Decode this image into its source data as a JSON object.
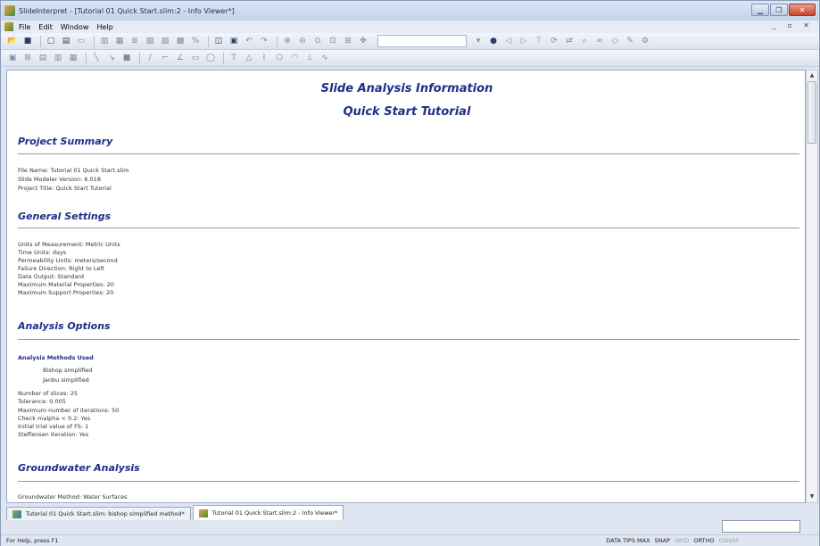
{
  "window": {
    "title": "SlideInterpret - [Tutorial 01 Quick Start.slim:2 - Info Viewer*]"
  },
  "menu": {
    "items": [
      "File",
      "Edit",
      "Window",
      "Help"
    ]
  },
  "doc": {
    "title_line1": "Slide Analysis Information",
    "title_line2": "Quick Start Tutorial",
    "sections": {
      "project_summary": {
        "heading": "Project Summary",
        "lines": [
          "File Name: Tutorial 01 Quick Start.slim",
          "Slide Modeler Version: 6.018",
          "Project Title: Quick Start Tutorial"
        ]
      },
      "general_settings": {
        "heading": "General Settings",
        "lines": [
          "Units of Measurement: Metric Units",
          "Time Units: days",
          "Permeability Units: meters/second",
          "Failure Direction: Right to Left",
          "Data Output: Standard",
          "Maximum Material Properties: 20",
          "Maximum Support Properties: 20"
        ]
      },
      "analysis_options": {
        "heading": "Analysis Options",
        "subheading": "Analysis Methods Used",
        "methods": [
          "Bishop simplified",
          "Janbu simplified"
        ],
        "lines": [
          "Number of slices: 25",
          "Tolerance: 0.005",
          "Maximum number of iterations: 50",
          "Check malpha < 0.2: Yes",
          "Initial trial value of FS: 1",
          "Steffensen Iteration: Yes"
        ]
      },
      "groundwater": {
        "heading": "Groundwater Analysis",
        "lines": [
          "Groundwater Method: Water Surfaces"
        ]
      }
    }
  },
  "tabs": [
    {
      "label": "Tutorial 01 Quick Start.slim: bishop simplified method*"
    },
    {
      "label": "Tutorial 01 Quick Start.slim:2 - Info Viewer*"
    }
  ],
  "status": {
    "help_text": "For Help, press F1",
    "flags": [
      {
        "label": "DATA TIPS MAX",
        "active": true
      },
      {
        "label": "SNAP",
        "active": true
      },
      {
        "label": "GRID",
        "active": false
      },
      {
        "label": "ORTHO",
        "active": true
      },
      {
        "label": "OSNAP",
        "active": false
      }
    ]
  }
}
